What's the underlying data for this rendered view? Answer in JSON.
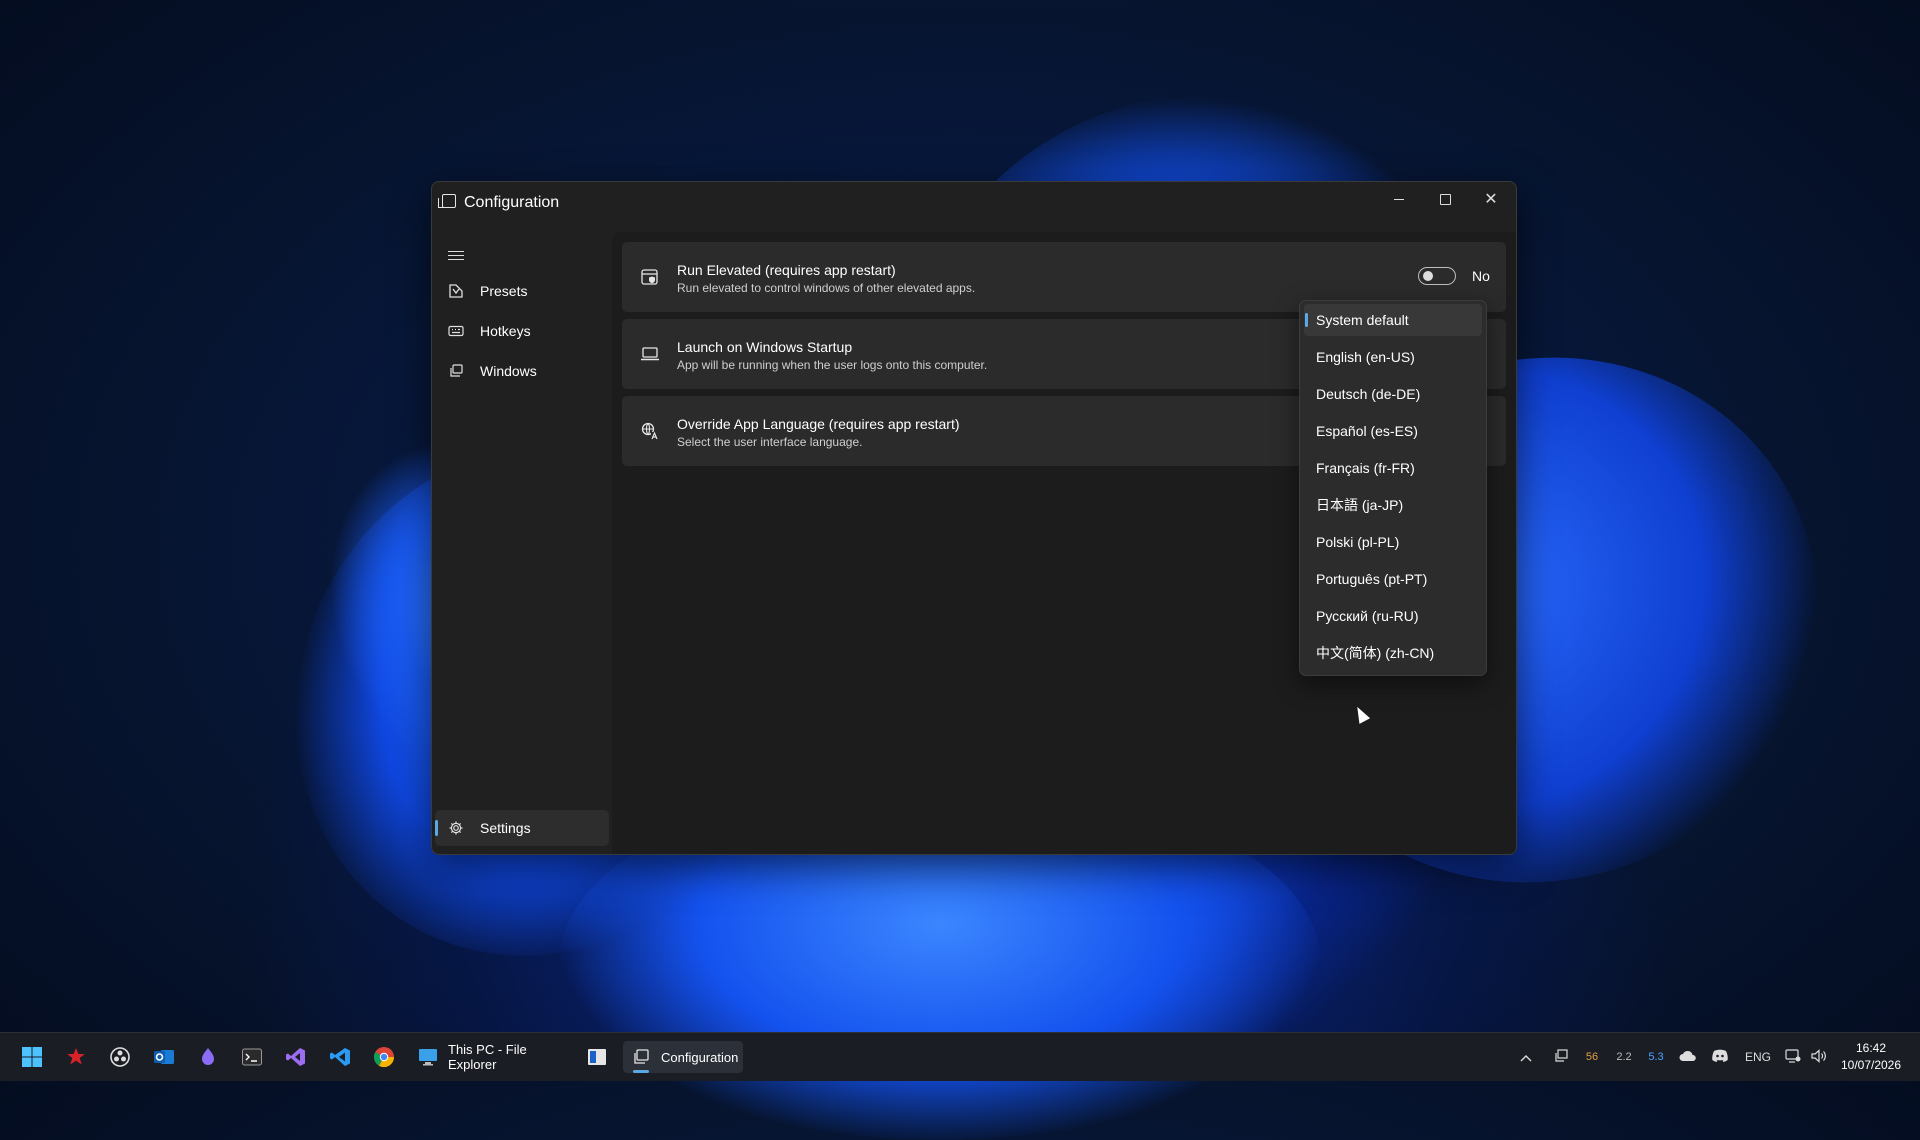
{
  "window": {
    "title": "Configuration",
    "controls": {
      "minimize": "–",
      "maximize": "□",
      "close": "✕"
    }
  },
  "nav": {
    "items": [
      {
        "label": "Presets",
        "icon": "presets-icon"
      },
      {
        "label": "Hotkeys",
        "icon": "keyboard-icon"
      },
      {
        "label": "Windows",
        "icon": "windows-icon"
      }
    ],
    "footer": {
      "label": "Settings",
      "icon": "gear-icon",
      "selected": true
    }
  },
  "settings": [
    {
      "title": "Run Elevated (requires app restart)",
      "subtitle": "Run elevated to control windows of other elevated apps.",
      "icon": "shield-app-icon",
      "toggle": {
        "on": false,
        "text": "No"
      }
    },
    {
      "title": "Launch on Windows Startup",
      "subtitle": "App will be running when the user logs onto this computer.",
      "icon": "laptop-icon"
    },
    {
      "title": "Override App Language (requires app restart)",
      "subtitle": "Select the user interface language.",
      "icon": "language-icon"
    }
  ],
  "language_dropdown": {
    "selected_index": 0,
    "options": [
      "System default",
      "English (en-US)",
      "Deutsch (de-DE)",
      "Español (es-ES)",
      "Français (fr-FR)",
      "日本語 (ja-JP)",
      "Polski (pl-PL)",
      "Português (pt-PT)",
      "Русский (ru-RU)",
      "中文(简体) (zh-CN)"
    ]
  },
  "taskbar": {
    "apps": [
      {
        "label": "This PC - File Explorer",
        "icon": "computer-icon"
      },
      {
        "label": "Configuration",
        "icon": "configuration-icon",
        "active": true
      }
    ],
    "tray": {
      "values": [
        "56",
        "2.2",
        "5.3"
      ],
      "value_colors": [
        "#e0a040",
        "#bbbbbb",
        "#4aa3ff"
      ],
      "language": "ENG",
      "time": "16:42",
      "date": "10/07/2026"
    }
  },
  "colors": {
    "accent": "#5aa9e6",
    "window_bg": "#202020",
    "card_bg": "#2b2b2b"
  }
}
